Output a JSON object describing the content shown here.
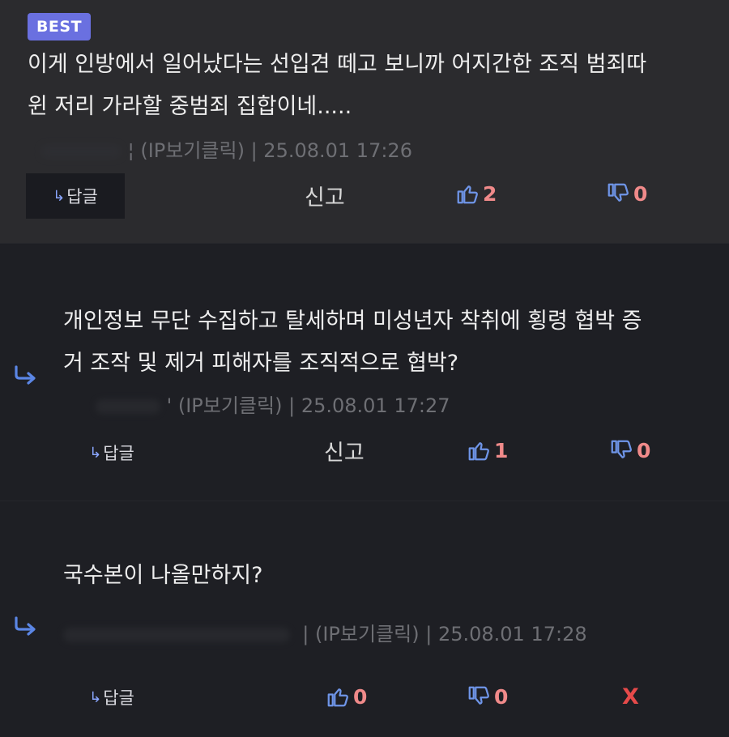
{
  "colors": {
    "best_badge": "#6a70e0",
    "accent_blue": "#5b86e5",
    "vote_count": "#f08a8a",
    "delete": "#e64a4a"
  },
  "comments": [
    {
      "badge": "BEST",
      "text_lines": [
        "이게 인방에서 일어났다는 선입견 떼고 보니까 어지간한 조직 범죄따",
        "윈 저리 가라할 중범죄 집합이네....."
      ],
      "ip_label": "(IP보기클릭)",
      "timestamp": "25.08.01 17:26",
      "reply_label": "답글",
      "report_label": "신고",
      "upvotes": "2",
      "downvotes": "0",
      "icons": [
        "thumbs-up-icon",
        "thumbs-down-icon",
        "reply-arrow-icon"
      ]
    },
    {
      "text_lines": [
        "개인정보 무단 수집하고 탈세하며 미성년자 착취에 횡령 협박 증",
        "거 조작 및 제거 피해자를 조직적으로 협박?"
      ],
      "ip_label": "(IP보기클릭)",
      "timestamp": "25.08.01 17:27",
      "reply_label": "답글",
      "report_label": "신고",
      "upvotes": "1",
      "downvotes": "0"
    },
    {
      "text_lines": [
        "국수본이 나올만하지?"
      ],
      "ip_label": "(IP보기클릭)",
      "timestamp": "25.08.01 17:28",
      "reply_label": "답글",
      "upvotes": "0",
      "downvotes": "0",
      "delete_label": "X"
    }
  ]
}
